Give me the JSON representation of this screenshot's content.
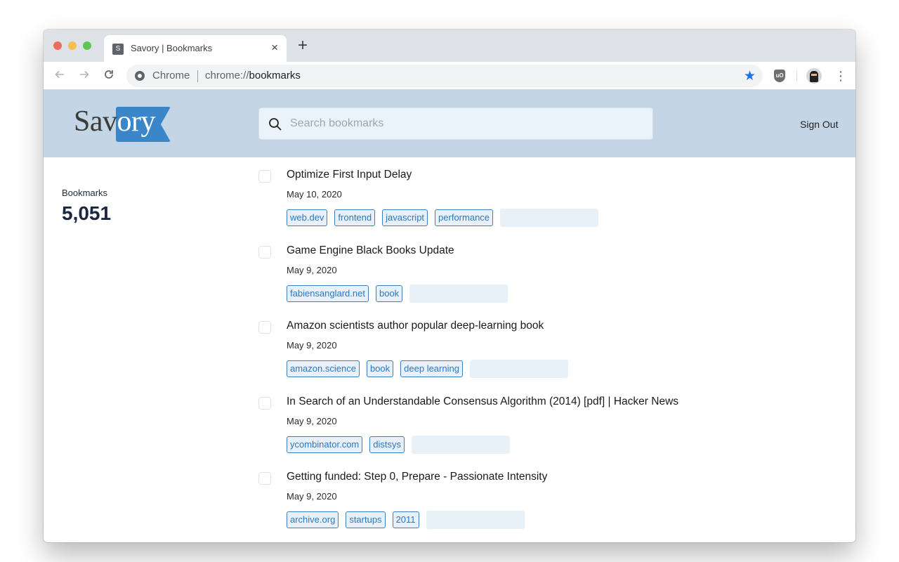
{
  "browser": {
    "tab": {
      "favicon_letter": "S",
      "title": "Savory | Bookmarks"
    },
    "new_tab_symbol": "+",
    "close_symbol": "×",
    "omnibox": {
      "chip": "Chrome",
      "url_prefix": "chrome://",
      "url_host": "bookmarks"
    },
    "extension_label": "uO",
    "icons": {
      "back": "arrow-left",
      "forward": "arrow-right",
      "reload": "reload",
      "bookmark_star": "star-filled",
      "menu": "three-dots-vertical"
    },
    "accent_color": "#1a73e8"
  },
  "app": {
    "logo": {
      "text_dark": "Sav",
      "text_light": "ory",
      "flag_color": "#3a86c8"
    },
    "search": {
      "placeholder": "Search bookmarks",
      "value": ""
    },
    "sign_out_label": "Sign Out",
    "header_color": "#c4d5e5"
  },
  "sidebar": {
    "label": "Bookmarks",
    "count": "5,051"
  },
  "bookmarks": [
    {
      "title": "Optimize First Input Delay",
      "date": "May 10, 2020",
      "tags": [
        "web.dev",
        "frontend",
        "javascript",
        "performance"
      ]
    },
    {
      "title": "Game Engine Black Books Update",
      "date": "May 9, 2020",
      "tags": [
        "fabiensanglard.net",
        "book"
      ]
    },
    {
      "title": "Amazon scientists author popular deep-learning book",
      "date": "May 9, 2020",
      "tags": [
        "amazon.science",
        "book",
        "deep learning"
      ]
    },
    {
      "title": "In Search of an Understandable Consensus Algorithm (2014) [pdf] | Hacker News",
      "date": "May 9, 2020",
      "tags": [
        "ycombinator.com",
        "distsys"
      ]
    },
    {
      "title": "Getting funded: Step 0, Prepare - Passionate Intensity",
      "date": "May 9, 2020",
      "tags": [
        "archive.org",
        "startups",
        "2011"
      ]
    }
  ]
}
